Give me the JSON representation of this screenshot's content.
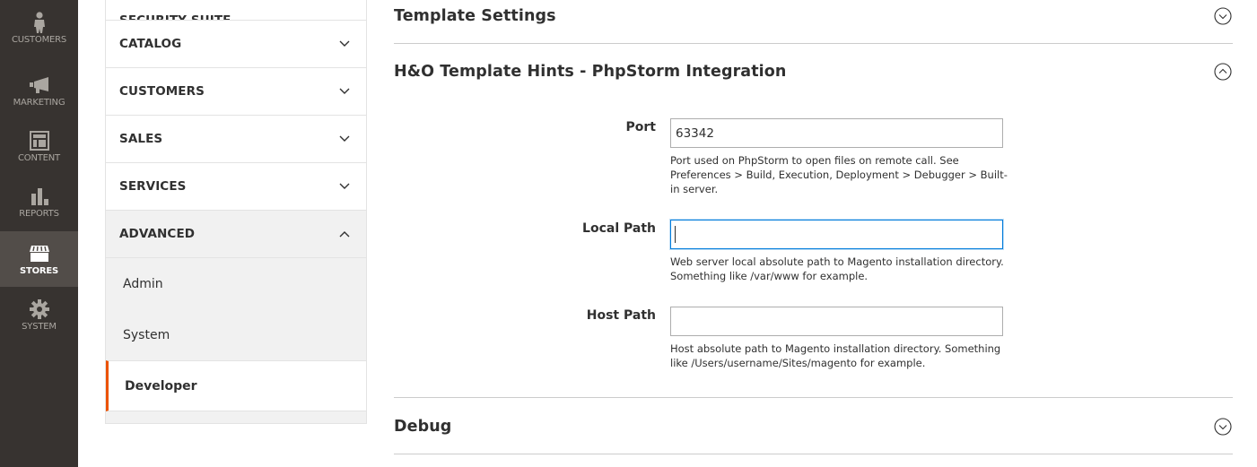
{
  "admin_nav": {
    "items": [
      {
        "label": "CUSTOMERS",
        "icon": "customer-icon",
        "active": false
      },
      {
        "label": "MARKETING",
        "icon": "megaphone-icon",
        "active": false
      },
      {
        "label": "CONTENT",
        "icon": "layout-icon",
        "active": false
      },
      {
        "label": "REPORTS",
        "icon": "bar-chart-icon",
        "active": false
      },
      {
        "label": "STORES",
        "icon": "storefront-icon",
        "active": true
      },
      {
        "label": "SYSTEM",
        "icon": "gear-icon",
        "active": false
      }
    ]
  },
  "config_tabs": {
    "groups": [
      {
        "title": "SECURITY SUITE",
        "expanded": false
      },
      {
        "title": "CATALOG",
        "expanded": false
      },
      {
        "title": "CUSTOMERS",
        "expanded": false
      },
      {
        "title": "SALES",
        "expanded": false
      },
      {
        "title": "SERVICES",
        "expanded": false
      },
      {
        "title": "ADVANCED",
        "expanded": true
      }
    ],
    "advanced_items": [
      {
        "label": "Admin",
        "active": false
      },
      {
        "label": "System",
        "active": false
      },
      {
        "label": "Developer",
        "active": true
      }
    ]
  },
  "sections": {
    "template_settings": {
      "title": "Template Settings",
      "expanded": false
    },
    "hints": {
      "title": "H&O Template Hints - PhpStorm Integration",
      "expanded": true,
      "fields": {
        "port": {
          "label": "Port",
          "value": "63342",
          "note": "Port used on PhpStorm to open files on remote call. See Preferences > Build, Execution, Deployment > Debugger > Built-in server."
        },
        "local_path": {
          "label": "Local Path",
          "value": "",
          "note": "Web server local absolute path to Magento installation directory. Something like /var/www for example."
        },
        "host_path": {
          "label": "Host Path",
          "value": "",
          "note": "Host absolute path to Magento installation directory. Something like /Users/username/Sites/magento for example."
        }
      }
    },
    "debug": {
      "title": "Debug",
      "expanded": false
    }
  },
  "colors": {
    "nav_bg": "#373330",
    "nav_active_bg": "#524d49",
    "accent": "#eb5202",
    "focus": "#007bdb"
  }
}
